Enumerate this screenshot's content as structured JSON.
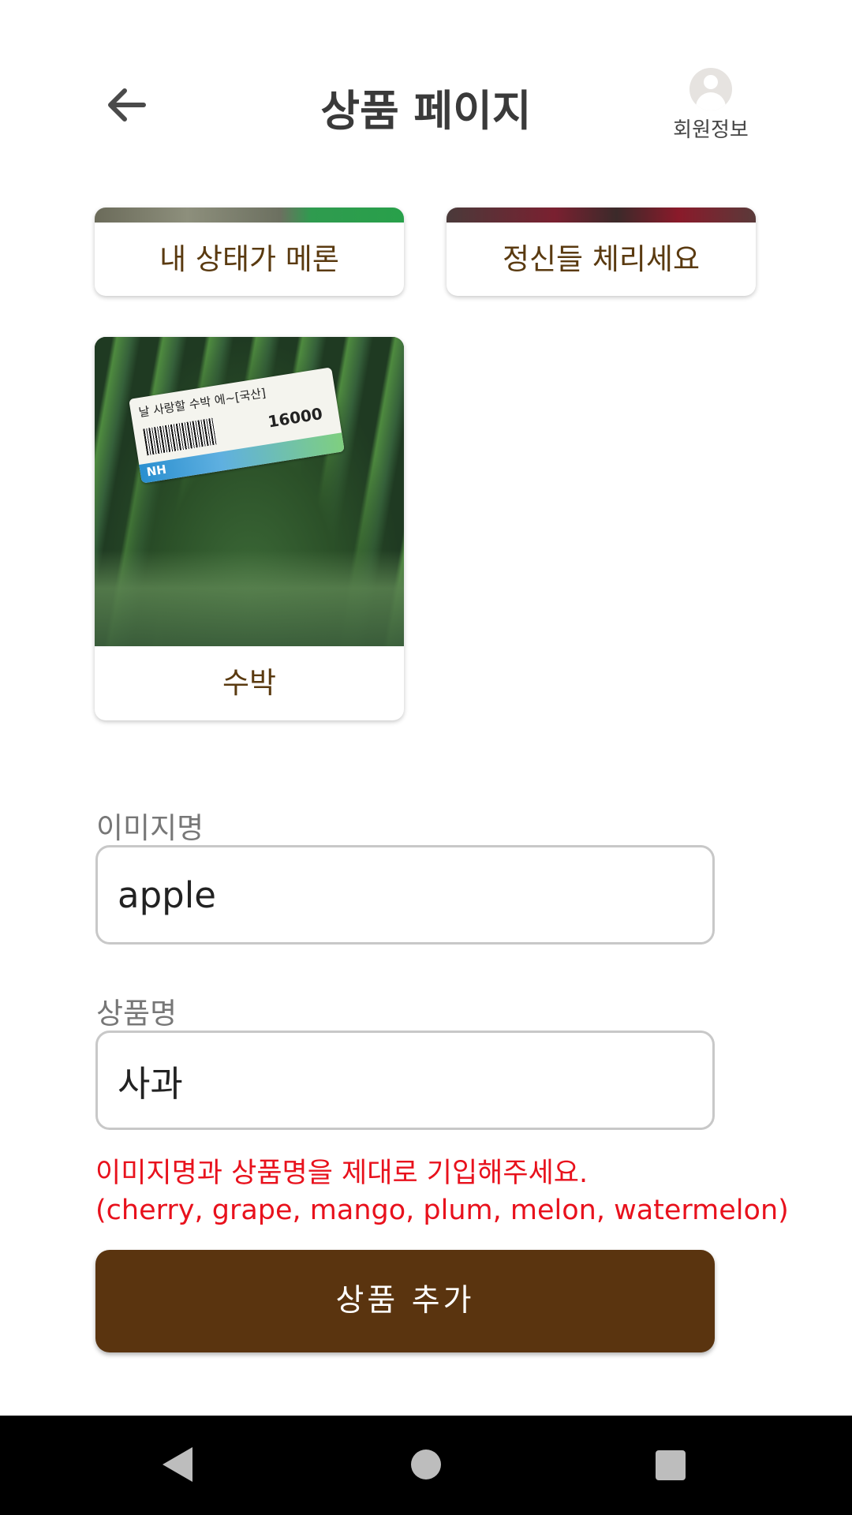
{
  "header": {
    "title": "상품 페이지",
    "back_icon": "arrow-left-icon",
    "profile_label": "회원정보",
    "profile_icon": "user-avatar-icon"
  },
  "products": [
    {
      "name": "내 상태가 메론"
    },
    {
      "name": "정신들 체리세요"
    },
    {
      "name": "수박",
      "image_label": {
        "line1": "날 사랑할 수박 에~[국산]",
        "price": "16000",
        "brand": "NH"
      }
    }
  ],
  "form": {
    "image_name_label": "이미지명",
    "image_name_value": "apple",
    "product_name_label": "상품명",
    "product_name_value": "사과",
    "error_line1": "이미지명과 상품명을 제대로 기입해주세요.",
    "error_line2": "(cherry, grape, mango, plum, melon, watermelon)",
    "submit_label": "상품 추가"
  },
  "colors": {
    "accent": "#5a340f",
    "error": "#e8111c",
    "card_text": "#5a3a10"
  },
  "navbar": {
    "icons": [
      "nav-back-icon",
      "nav-home-icon",
      "nav-recents-icon"
    ]
  }
}
